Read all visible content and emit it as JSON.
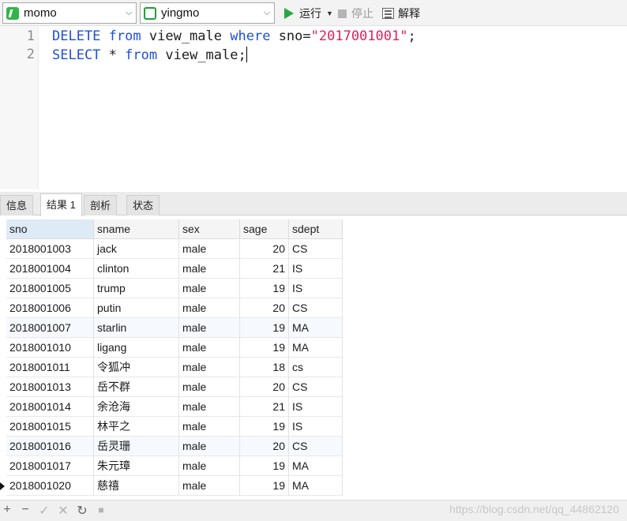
{
  "toolbar": {
    "connection": "momo",
    "database": "yingmo",
    "run_label": "运行",
    "stop_label": "停止",
    "explain_label": "解释",
    "icons": {
      "connection": "connection-icon",
      "database": "database-icon",
      "run": "play-icon",
      "stop": "stop-icon",
      "explain": "explain-icon"
    }
  },
  "editor": {
    "lines": [
      {
        "number": "1",
        "tokens": [
          "DELETE",
          "from",
          "view_male",
          "where",
          "sno=",
          "\"2017001001\"",
          ";"
        ]
      },
      {
        "number": "2",
        "tokens": [
          "SELECT",
          "*",
          "from",
          "view_male;"
        ]
      }
    ]
  },
  "tabs": [
    "信息",
    "结果 1",
    "剖析",
    "状态"
  ],
  "active_tab": "结果 1",
  "result": {
    "columns": [
      "sno",
      "sname",
      "sex",
      "sage",
      "sdept"
    ],
    "rows": [
      [
        "2018001003",
        "jack",
        "male",
        "20",
        "CS"
      ],
      [
        "2018001004",
        "clinton",
        "male",
        "21",
        "IS"
      ],
      [
        "2018001005",
        "trump",
        "male",
        "19",
        "IS"
      ],
      [
        "2018001006",
        "putin",
        "male",
        "20",
        "CS"
      ],
      [
        "2018001007",
        "starlin",
        "male",
        "19",
        "MA"
      ],
      [
        "2018001010",
        "ligang",
        "male",
        "19",
        "MA"
      ],
      [
        "2018001011",
        "令狐冲",
        "male",
        "18",
        "cs"
      ],
      [
        "2018001013",
        "岳不群",
        "male",
        "20",
        "CS"
      ],
      [
        "2018001014",
        "余沧海",
        "male",
        "21",
        "IS"
      ],
      [
        "2018001015",
        "林平之",
        "male",
        "19",
        "IS"
      ],
      [
        "2018001016",
        "岳灵珊",
        "male",
        "20",
        "CS"
      ],
      [
        "2018001017",
        "朱元璋",
        "male",
        "19",
        "MA"
      ],
      [
        "2018001020",
        "慈禧",
        "male",
        "19",
        "MA"
      ]
    ]
  },
  "bottom": {
    "buttons": [
      "+",
      "−",
      "✓",
      "✕",
      "↻",
      "■"
    ],
    "watermark": "https://blog.csdn.net/qq_44862120"
  },
  "colors": {
    "keyword": "#1f4fd8",
    "string": "#e0205a",
    "run": "#27a844"
  }
}
